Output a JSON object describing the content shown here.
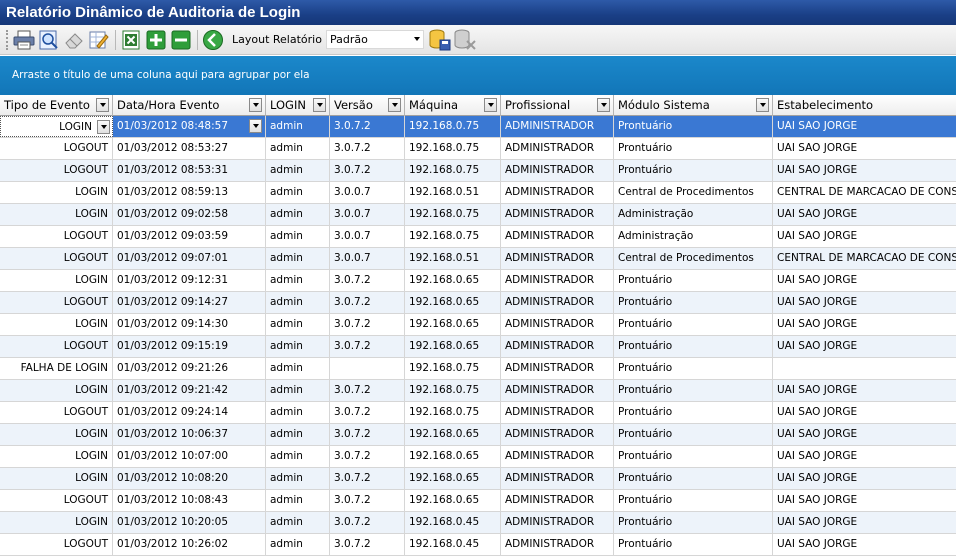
{
  "window": {
    "title": "Relatório Dinâmico de Auditoria de Login"
  },
  "toolbar": {
    "buttons": [
      {
        "icon": "printer-icon"
      },
      {
        "icon": "print-preview-icon"
      },
      {
        "icon": "eraser-icon"
      },
      {
        "icon": "edit-layout-icon"
      },
      {
        "icon": "excel-export-icon"
      },
      {
        "icon": "expand-plus-icon"
      },
      {
        "icon": "collapse-minus-icon"
      },
      {
        "icon": "back-arrow-icon"
      }
    ],
    "layout_label": "Layout Relatório",
    "layout_value": "Padrão",
    "save_icon": "save-database-icon",
    "delete_icon": "delete-database-icon"
  },
  "group_bar": {
    "text": "Arraste o título de uma coluna aqui para agrupar por ela"
  },
  "columns": [
    "Tipo de Evento",
    "Data/Hora Evento",
    "LOGIN",
    "Versão",
    "Máquina",
    "Profissional",
    "Módulo Sistema",
    "Estabelecimento"
  ],
  "rows": [
    [
      "LOGIN",
      "01/03/2012 08:48:57",
      "admin",
      "3.0.7.2",
      "192.168.0.75",
      "ADMINISTRADOR",
      "Prontuário",
      "UAI SAO JORGE"
    ],
    [
      "LOGOUT",
      "01/03/2012 08:53:27",
      "admin",
      "3.0.7.2",
      "192.168.0.75",
      "ADMINISTRADOR",
      "Prontuário",
      "UAI SAO JORGE"
    ],
    [
      "LOGOUT",
      "01/03/2012 08:53:31",
      "admin",
      "3.0.7.2",
      "192.168.0.75",
      "ADMINISTRADOR",
      "Prontuário",
      "UAI SAO JORGE"
    ],
    [
      "LOGIN",
      "01/03/2012 08:59:13",
      "admin",
      "3.0.0.7",
      "192.168.0.51",
      "ADMINISTRADOR",
      "Central de Procedimentos",
      "CENTRAL DE MARCACAO DE CONSULT"
    ],
    [
      "LOGIN",
      "01/03/2012 09:02:58",
      "admin",
      "3.0.0.7",
      "192.168.0.75",
      "ADMINISTRADOR",
      "Administração",
      "UAI SAO JORGE"
    ],
    [
      "LOGOUT",
      "01/03/2012 09:03:59",
      "admin",
      "3.0.0.7",
      "192.168.0.75",
      "ADMINISTRADOR",
      "Administração",
      "UAI SAO JORGE"
    ],
    [
      "LOGOUT",
      "01/03/2012 09:07:01",
      "admin",
      "3.0.0.7",
      "192.168.0.51",
      "ADMINISTRADOR",
      "Central de Procedimentos",
      "CENTRAL DE MARCACAO DE CONSULT"
    ],
    [
      "LOGIN",
      "01/03/2012 09:12:31",
      "admin",
      "3.0.7.2",
      "192.168.0.65",
      "ADMINISTRADOR",
      "Prontuário",
      "UAI SAO JORGE"
    ],
    [
      "LOGOUT",
      "01/03/2012 09:14:27",
      "admin",
      "3.0.7.2",
      "192.168.0.65",
      "ADMINISTRADOR",
      "Prontuário",
      "UAI SAO JORGE"
    ],
    [
      "LOGIN",
      "01/03/2012 09:14:30",
      "admin",
      "3.0.7.2",
      "192.168.0.65",
      "ADMINISTRADOR",
      "Prontuário",
      "UAI SAO JORGE"
    ],
    [
      "LOGOUT",
      "01/03/2012 09:15:19",
      "admin",
      "3.0.7.2",
      "192.168.0.65",
      "ADMINISTRADOR",
      "Prontuário",
      "UAI SAO JORGE"
    ],
    [
      "FALHA DE LOGIN",
      "01/03/2012 09:21:26",
      "admin",
      "",
      "192.168.0.75",
      "ADMINISTRADOR",
      "Prontuário",
      ""
    ],
    [
      "LOGIN",
      "01/03/2012 09:21:42",
      "admin",
      "3.0.7.2",
      "192.168.0.75",
      "ADMINISTRADOR",
      "Prontuário",
      "UAI SAO JORGE"
    ],
    [
      "LOGOUT",
      "01/03/2012 09:24:14",
      "admin",
      "3.0.7.2",
      "192.168.0.75",
      "ADMINISTRADOR",
      "Prontuário",
      "UAI SAO JORGE"
    ],
    [
      "LOGIN",
      "01/03/2012 10:06:37",
      "admin",
      "3.0.7.2",
      "192.168.0.65",
      "ADMINISTRADOR",
      "Prontuário",
      "UAI SAO JORGE"
    ],
    [
      "LOGIN",
      "01/03/2012 10:07:00",
      "admin",
      "3.0.7.2",
      "192.168.0.65",
      "ADMINISTRADOR",
      "Prontuário",
      "UAI SAO JORGE"
    ],
    [
      "LOGIN",
      "01/03/2012 10:08:20",
      "admin",
      "3.0.7.2",
      "192.168.0.65",
      "ADMINISTRADOR",
      "Prontuário",
      "UAI SAO JORGE"
    ],
    [
      "LOGOUT",
      "01/03/2012 10:08:43",
      "admin",
      "3.0.7.2",
      "192.168.0.65",
      "ADMINISTRADOR",
      "Prontuário",
      "UAI SAO JORGE"
    ],
    [
      "LOGIN",
      "01/03/2012 10:20:05",
      "admin",
      "3.0.7.2",
      "192.168.0.45",
      "ADMINISTRADOR",
      "Prontuário",
      "UAI SAO JORGE"
    ],
    [
      "LOGOUT",
      "01/03/2012 10:26:02",
      "admin",
      "3.0.7.2",
      "192.168.0.45",
      "ADMINISTRADOR",
      "Prontuário",
      "UAI SAO JORGE"
    ]
  ],
  "colors": {
    "title_bar": "#1a3f86",
    "group_bar": "#1276b8",
    "selected_row": "#3a78d3",
    "alt_row": "#edf3fa"
  }
}
